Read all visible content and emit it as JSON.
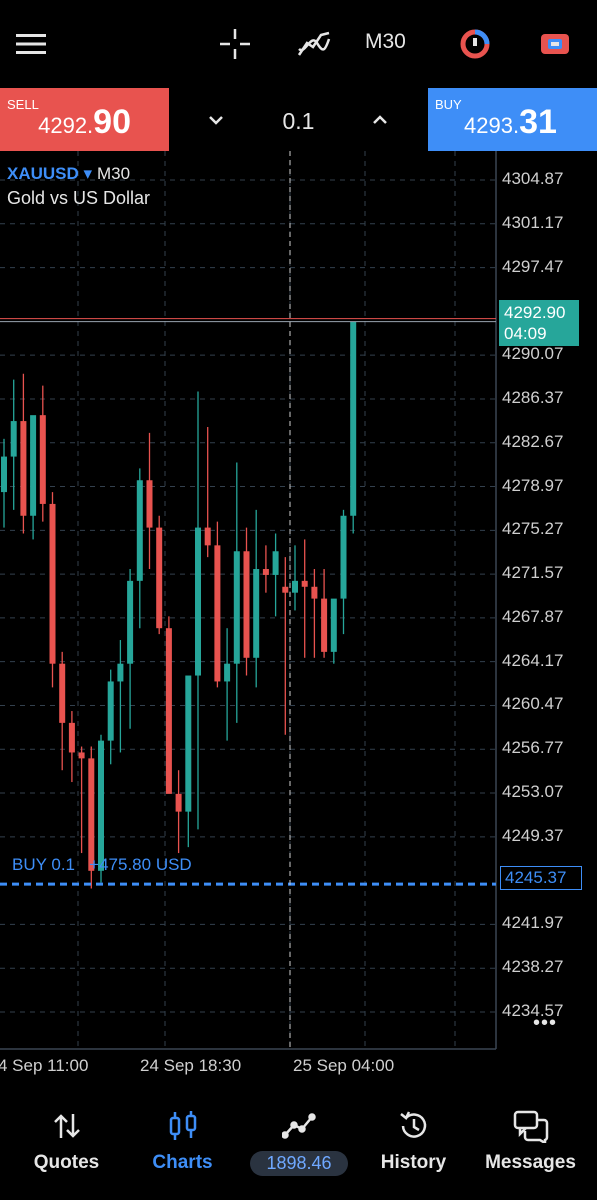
{
  "toolbar": {
    "timeframe": "M30",
    "icons": [
      "menu-icon",
      "crosshair-icon",
      "indicators-icon",
      "objects-icon",
      "trade-panel-icon"
    ]
  },
  "trade": {
    "sell_label": "SELL",
    "sell_price_small": "4292.",
    "sell_price_big": "90",
    "lot": "0.1",
    "buy_label": "BUY",
    "buy_price_small": "4293.",
    "buy_price_big": "31"
  },
  "chart_data": {
    "type": "candlestick",
    "symbol": "XAUUSD",
    "timeframe": "M30",
    "description": "Gold vs US Dollar",
    "ylim": [
      4232.0,
      4307.0
    ],
    "y_ticks": [
      "4304.87",
      "4301.17",
      "4297.47",
      "4290.07",
      "4286.37",
      "4282.67",
      "4278.97",
      "4275.27",
      "4271.57",
      "4267.87",
      "4264.17",
      "4260.47",
      "4256.77",
      "4253.07",
      "4249.37",
      "4241.97",
      "4238.27",
      "4234.57"
    ],
    "x_ticks": [
      "4 Sep 11:00",
      "24 Sep 18:30",
      "25 Sep 04:00"
    ],
    "current_price": "4292.90",
    "countdown": "04:09",
    "position_line_price": "4245.37",
    "position_label": "BUY 0.1   +475.80 USD",
    "candles": [
      {
        "o": 4278.5,
        "h": 4283.0,
        "l": 4275.5,
        "c": 4281.5
      },
      {
        "o": 4281.5,
        "h": 4288.0,
        "l": 4277.0,
        "c": 4284.5
      },
      {
        "o": 4284.5,
        "h": 4288.5,
        "l": 4275.0,
        "c": 4276.5
      },
      {
        "o": 4276.5,
        "h": 4284.0,
        "l": 4274.5,
        "c": 4285.0
      },
      {
        "o": 4285.0,
        "h": 4287.5,
        "l": 4276.0,
        "c": 4277.5
      },
      {
        "o": 4277.5,
        "h": 4278.5,
        "l": 4262.0,
        "c": 4264.0
      },
      {
        "o": 4264.0,
        "h": 4265.0,
        "l": 4255.0,
        "c": 4259.0
      },
      {
        "o": 4259.0,
        "h": 4260.0,
        "l": 4254.0,
        "c": 4256.5
      },
      {
        "o": 4256.5,
        "h": 4257.0,
        "l": 4248.0,
        "c": 4256.0
      },
      {
        "o": 4256.0,
        "h": 4257.0,
        "l": 4245.0,
        "c": 4246.5
      },
      {
        "o": 4246.5,
        "h": 4258.0,
        "l": 4245.5,
        "c": 4257.5
      },
      {
        "o": 4257.5,
        "h": 4263.5,
        "l": 4255.5,
        "c": 4262.5
      },
      {
        "o": 4262.5,
        "h": 4266.0,
        "l": 4256.5,
        "c": 4264.0
      },
      {
        "o": 4264.0,
        "h": 4272.0,
        "l": 4258.5,
        "c": 4271.0
      },
      {
        "o": 4271.0,
        "h": 4280.5,
        "l": 4267.0,
        "c": 4279.5
      },
      {
        "o": 4279.5,
        "h": 4283.5,
        "l": 4272.0,
        "c": 4275.5
      },
      {
        "o": 4275.5,
        "h": 4276.5,
        "l": 4266.5,
        "c": 4267.0
      },
      {
        "o": 4267.0,
        "h": 4268.0,
        "l": 4254.0,
        "c": 4253.0
      },
      {
        "o": 4253.0,
        "h": 4255.0,
        "l": 4248.0,
        "c": 4251.5
      },
      {
        "o": 4251.5,
        "h": 4262.0,
        "l": 4248.5,
        "c": 4263.0
      },
      {
        "o": 4263.0,
        "h": 4287.0,
        "l": 4250.0,
        "c": 4275.5
      },
      {
        "o": 4275.5,
        "h": 4284.0,
        "l": 4273.0,
        "c": 4274.0
      },
      {
        "o": 4274.0,
        "h": 4276.0,
        "l": 4262.0,
        "c": 4262.5
      },
      {
        "o": 4262.5,
        "h": 4267.0,
        "l": 4257.5,
        "c": 4264.0
      },
      {
        "o": 4264.0,
        "h": 4281.0,
        "l": 4259.0,
        "c": 4273.5
      },
      {
        "o": 4273.5,
        "h": 4275.5,
        "l": 4263.0,
        "c": 4264.5
      },
      {
        "o": 4264.5,
        "h": 4277.0,
        "l": 4262.0,
        "c": 4272.0
      },
      {
        "o": 4272.0,
        "h": 4274.0,
        "l": 4270.0,
        "c": 4271.5
      },
      {
        "o": 4271.5,
        "h": 4275.0,
        "l": 4268.0,
        "c": 4273.5
      },
      {
        "o": 4270.5,
        "h": 4273.0,
        "l": 4258.0,
        "c": 4270.0
      },
      {
        "o": 4270.0,
        "h": 4274.0,
        "l": 4268.5,
        "c": 4271.0
      },
      {
        "o": 4271.0,
        "h": 4274.5,
        "l": 4264.5,
        "c": 4270.5
      },
      {
        "o": 4270.5,
        "h": 4272.0,
        "l": 4264.5,
        "c": 4269.5
      },
      {
        "o": 4269.5,
        "h": 4272.0,
        "l": 4264.5,
        "c": 4265.0
      },
      {
        "o": 4265.0,
        "h": 4268.0,
        "l": 4264.0,
        "c": 4269.5
      },
      {
        "o": 4269.5,
        "h": 4277.0,
        "l": 4266.5,
        "c": 4276.5
      },
      {
        "o": 4276.5,
        "h": 4277.0,
        "l": 4275.0,
        "c": 4292.9
      }
    ],
    "colors": {
      "bull": "#26a69a",
      "bear": "#e8534f",
      "grid": "#33404d",
      "position": "#3e8ef7"
    }
  },
  "nav": {
    "items": [
      {
        "label": "Quotes",
        "icon": "quotes-icon"
      },
      {
        "label": "Charts",
        "icon": "charts-icon"
      },
      {
        "label": "",
        "icon": "trade-icon"
      },
      {
        "label": "History",
        "icon": "history-icon"
      },
      {
        "label": "Messages",
        "icon": "messages-icon"
      }
    ],
    "balance": "1898.46"
  }
}
